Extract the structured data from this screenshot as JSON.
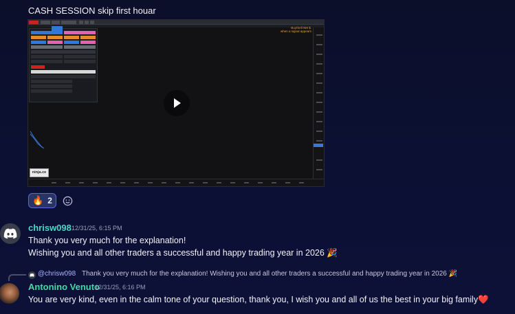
{
  "message_top": {
    "text": "CASH SESSION skip first houar"
  },
  "video": {
    "signal_text_line1": "Buy/Sell NM $.",
    "signal_text_line2": "when a signal appears",
    "logo_text": "ninja.ce"
  },
  "reactions": [
    {
      "emoji": "🔥",
      "count": "2"
    }
  ],
  "messages": [
    {
      "username": "chrisw098",
      "timestamp": "12/31/25, 6:15 PM",
      "avatar_icon": "discord-icon",
      "lines": [
        "Thank you very much for the explanation!",
        "Wishing you and all other traders a successful and happy trading year in 2026 🎉"
      ]
    },
    {
      "reply": {
        "mention": "@chrisw098",
        "text": "Thank you very much for the explanation! Wishing you and all other traders a successful and happy trading year in 2026 🎉"
      },
      "username": "Antonino Venuto",
      "timestamp": "12/31/25, 6:16 PM",
      "lines": [
        "You are very kind, even in the calm tone of your question, thank you, I wish you and all of us the best in your big family❤️"
      ]
    }
  ],
  "colors": {
    "accent_user_1": "#46d8c8",
    "accent_user_2": "#46d8a8",
    "reaction_border": "#5a69d8",
    "mention": "#a9b4ff"
  }
}
